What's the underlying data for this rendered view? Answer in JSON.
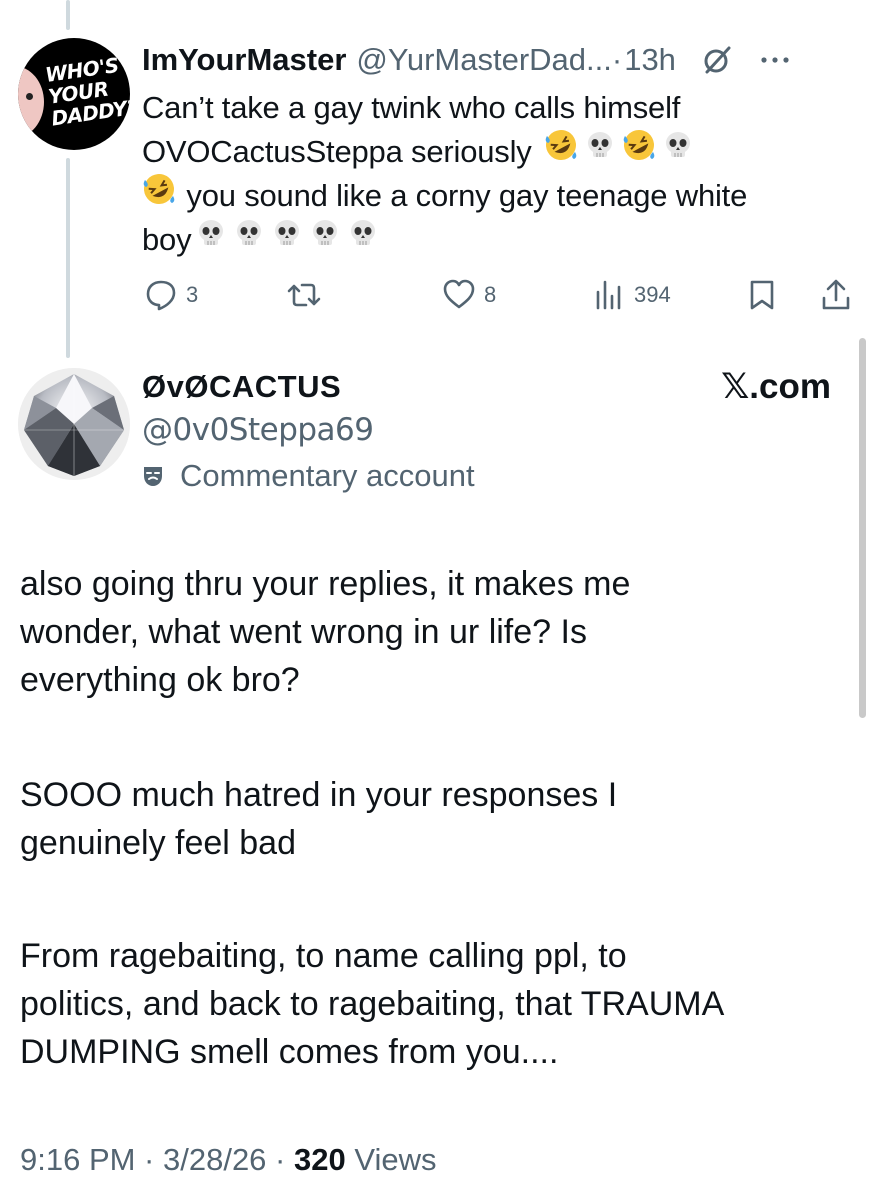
{
  "reply": {
    "name": "ImYourMaster",
    "handle": "@YurMasterDad...",
    "separator": "·",
    "time": "13h",
    "avatar_text": "WHO'S YOUR DADDY?",
    "text_lines": [
      "Can’t take a gay twink who calls himself",
      "OVOCactusSteppa seriously",
      "you sound like a corny gay teenage white",
      "boy"
    ],
    "emoji": [
      "rofl",
      "skull",
      "rofl",
      "skull",
      "rofl",
      "skull",
      "skull",
      "skull",
      "skull",
      "skull"
    ],
    "actions": {
      "replies": "3",
      "reposts": "",
      "likes": "8",
      "views": "394"
    },
    "icons": [
      "grok-icon",
      "more-icon",
      "reply-icon",
      "repost-icon",
      "like-icon",
      "views-icon",
      "bookmark-icon",
      "share-icon"
    ]
  },
  "tweet": {
    "name": "ØvØCACTUS",
    "handle": "@0v0Steppa69",
    "label": "Commentary account",
    "label_icon": "mask-icon",
    "brand": "𝕏.com",
    "paragraphs": [
      [
        "also going thru your replies, it makes me",
        "wonder, what went wrong in ur life? Is",
        "everything ok bro?"
      ],
      [
        "SOOO much hatred in your responses I",
        "genuinely feel bad"
      ],
      [
        "From ragebaiting, to name calling ppl, to",
        "politics, and back to ragebaiting, that TRAUMA",
        "DUMPING smell comes from you...."
      ]
    ],
    "timestamp": "9:16 PM · 3/28/26 · ",
    "views_count": "320",
    "views_label": " Views"
  },
  "colors": {
    "text": "#0f1419",
    "muted": "#536471",
    "thread_line": "#cfd9de",
    "emoji_face": "#f8c63a",
    "tear": "#49a6e8"
  }
}
